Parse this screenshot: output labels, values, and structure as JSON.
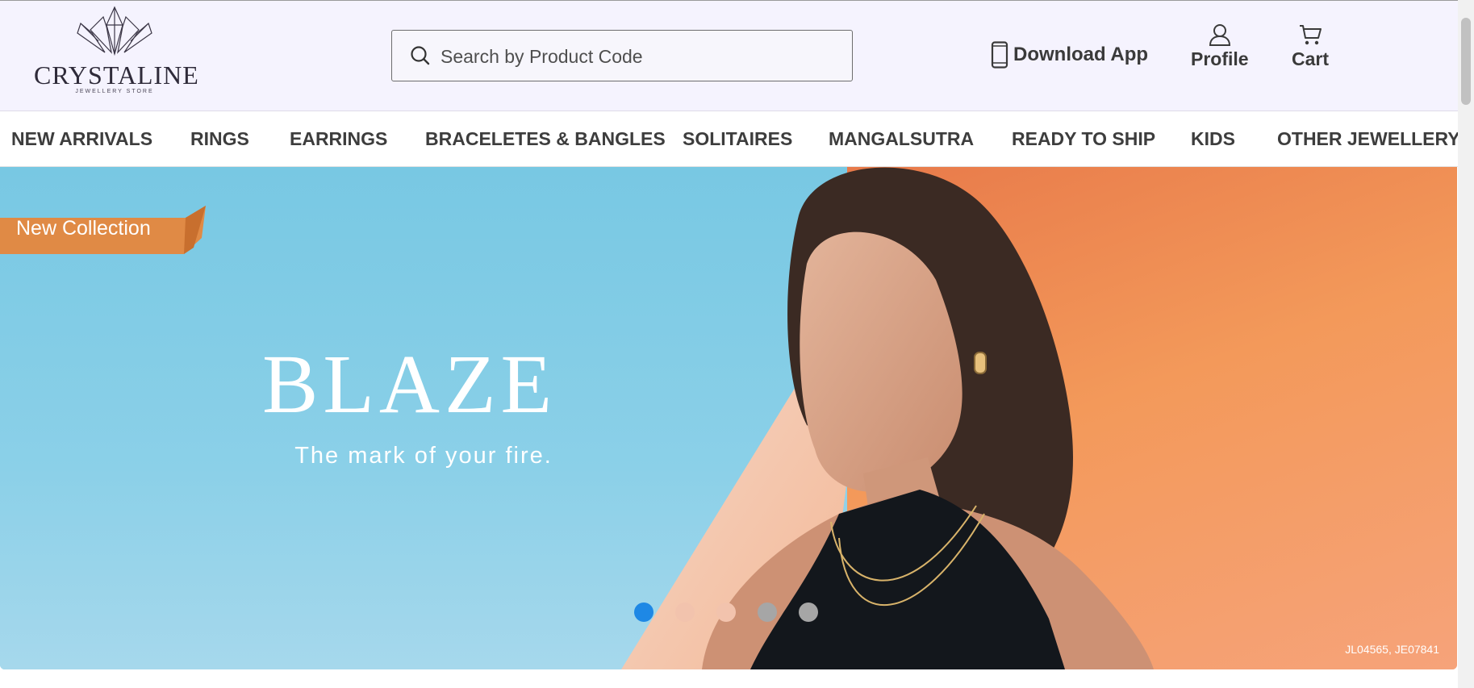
{
  "logo": {
    "name": "CRYSTALINE",
    "subtitle": "JEWELLERY STORE"
  },
  "search": {
    "placeholder": "Search by Product Code",
    "icon": "search-icon"
  },
  "header": {
    "download_app": "Download App",
    "profile": "Profile",
    "cart": "Cart"
  },
  "nav": {
    "items": [
      {
        "label": "NEW ARRIVALS"
      },
      {
        "label": "RINGS"
      },
      {
        "label": "EARRINGS"
      },
      {
        "label": "BRACELETES & BANGLES"
      },
      {
        "label": "SOLITAIRES"
      },
      {
        "label": "MANGALSUTRA"
      },
      {
        "label": "READY TO SHIP"
      },
      {
        "label": "KIDS"
      },
      {
        "label": "OTHER JEWELLERY"
      }
    ]
  },
  "hero": {
    "badge": "New Collection",
    "brand": "BLAZE",
    "tagline": "The mark of your fire.",
    "product_codes": "JL04565, JE07841",
    "slide_count": 5,
    "active_slide": 1
  },
  "colors": {
    "header_bg": "#f5f3fe",
    "text": "#3a3a3a",
    "ribbon": "#e08a45",
    "active_dot": "#1e88e5"
  }
}
